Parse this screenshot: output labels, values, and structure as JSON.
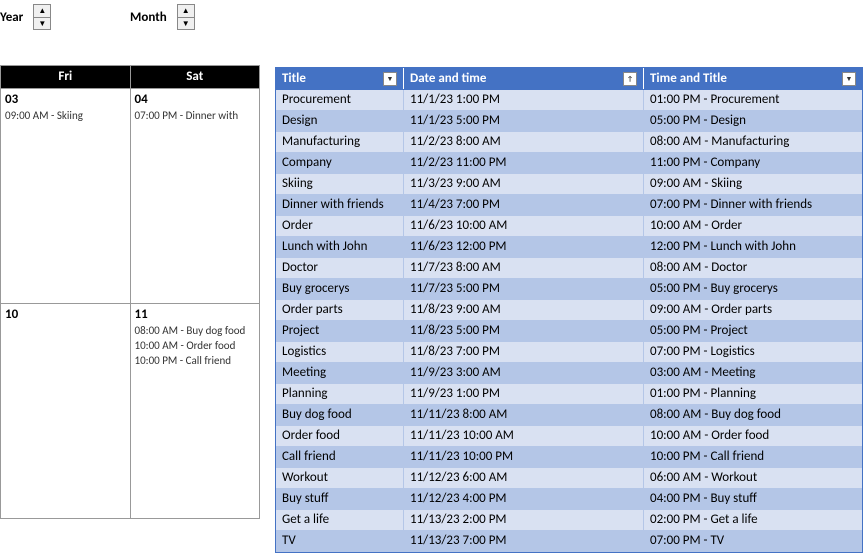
{
  "controls": {
    "year_label": "Year",
    "month_label": "Month"
  },
  "calendar": {
    "headers": [
      "Fri",
      "Sat"
    ],
    "rows": [
      {
        "cells": [
          {
            "day": "03",
            "events": [
              "09:00 AM - Skiing"
            ]
          },
          {
            "day": "04",
            "events": [
              "07:00 PM - Dinner with"
            ]
          }
        ]
      },
      {
        "cells": [
          {
            "day": "10",
            "events": []
          },
          {
            "day": "11",
            "events": [
              "08:00 AM - Buy dog food",
              "10:00 AM - Order food",
              "10:00 PM - Call friend"
            ]
          }
        ]
      }
    ]
  },
  "table": {
    "headers": {
      "title": "Title",
      "datetime": "Date and time",
      "timetitle": "Time and Title"
    },
    "rows": [
      {
        "title": "Procurement",
        "dt": "11/1/23 1:00 PM",
        "tt": "01:00 PM - Procurement"
      },
      {
        "title": "Design",
        "dt": "11/1/23 5:00 PM",
        "tt": "05:00 PM - Design"
      },
      {
        "title": "Manufacturing",
        "dt": "11/2/23 8:00 AM",
        "tt": "08:00 AM - Manufacturing"
      },
      {
        "title": "Company",
        "dt": "11/2/23 11:00 PM",
        "tt": "11:00 PM - Company"
      },
      {
        "title": "Skiing",
        "dt": "11/3/23 9:00 AM",
        "tt": "09:00 AM - Skiing"
      },
      {
        "title": "Dinner with friends",
        "dt": "11/4/23 7:00 PM",
        "tt": "07:00 PM - Dinner with friends"
      },
      {
        "title": "Order",
        "dt": "11/6/23 10:00 AM",
        "tt": "10:00 AM - Order"
      },
      {
        "title": "Lunch with John",
        "dt": "11/6/23 12:00 PM",
        "tt": "12:00 PM - Lunch with John"
      },
      {
        "title": "Doctor",
        "dt": "11/7/23 8:00 AM",
        "tt": "08:00 AM - Doctor"
      },
      {
        "title": "Buy grocerys",
        "dt": "11/7/23 5:00 PM",
        "tt": "05:00 PM - Buy grocerys"
      },
      {
        "title": "Order parts",
        "dt": "11/8/23 9:00 AM",
        "tt": "09:00 AM - Order parts"
      },
      {
        "title": "Project",
        "dt": "11/8/23 5:00 PM",
        "tt": "05:00 PM - Project"
      },
      {
        "title": "Logistics",
        "dt": "11/8/23 7:00 PM",
        "tt": "07:00 PM - Logistics"
      },
      {
        "title": "Meeting",
        "dt": "11/9/23 3:00 AM",
        "tt": "03:00 AM - Meeting"
      },
      {
        "title": "Planning",
        "dt": "11/9/23 1:00 PM",
        "tt": "01:00 PM - Planning"
      },
      {
        "title": "Buy dog food",
        "dt": "11/11/23 8:00 AM",
        "tt": "08:00 AM - Buy dog food"
      },
      {
        "title": "Order food",
        "dt": "11/11/23 10:00 AM",
        "tt": "10:00 AM - Order food"
      },
      {
        "title": "Call friend",
        "dt": "11/11/23 10:00 PM",
        "tt": "10:00 PM - Call friend"
      },
      {
        "title": "Workout",
        "dt": "11/12/23 6:00 AM",
        "tt": "06:00 AM - Workout"
      },
      {
        "title": "Buy stuff",
        "dt": "11/12/23 4:00 PM",
        "tt": "04:00 PM - Buy stuff"
      },
      {
        "title": "Get a life",
        "dt": "11/13/23 2:00 PM",
        "tt": "02:00 PM - Get a life"
      },
      {
        "title": "TV",
        "dt": "11/13/23 7:00 PM",
        "tt": "07:00 PM - TV"
      }
    ]
  }
}
